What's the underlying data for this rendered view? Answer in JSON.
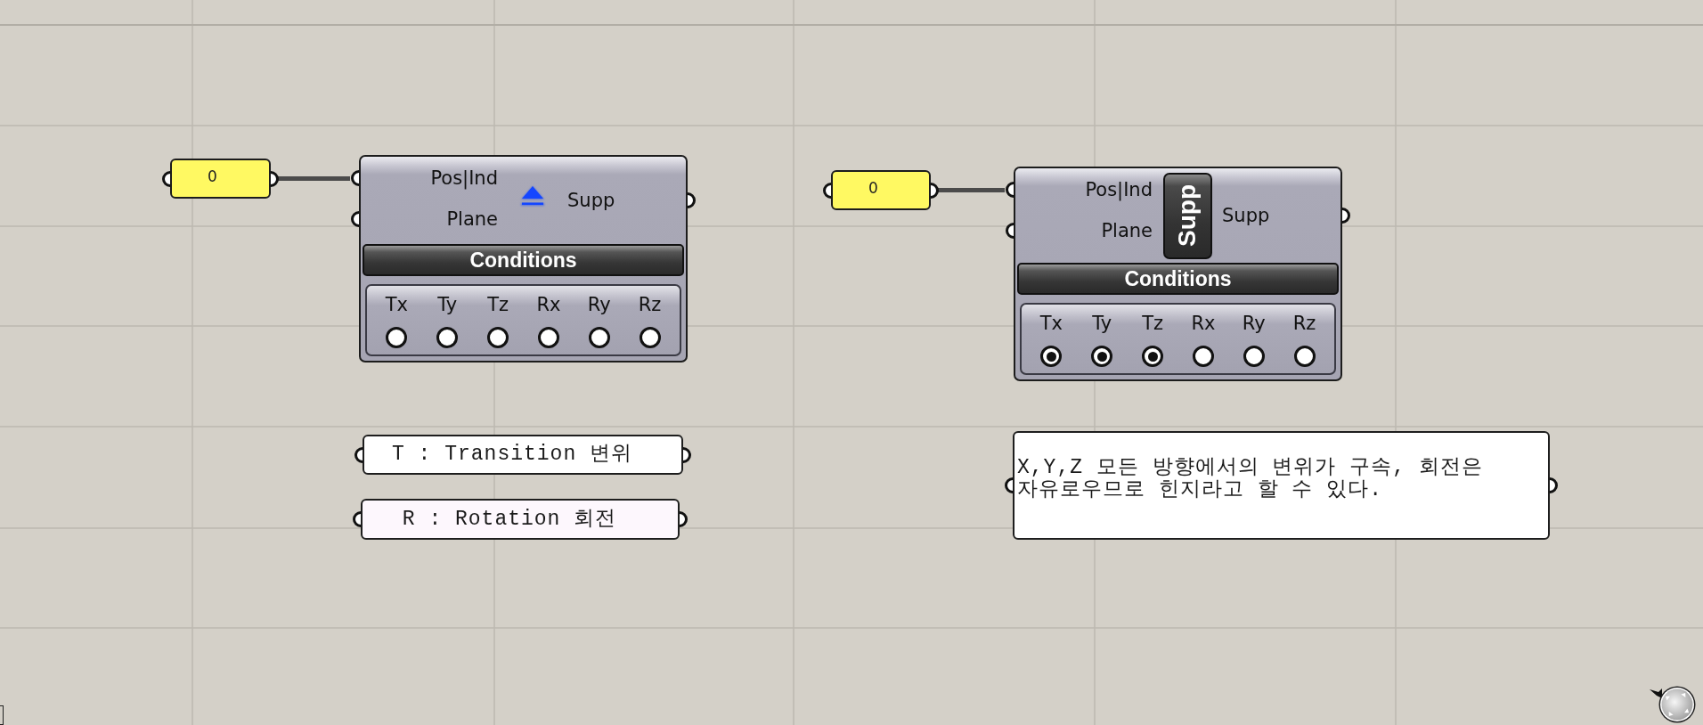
{
  "canvas": {
    "groups": [
      {
        "slider": {
          "value": "0"
        },
        "component": {
          "kind": "icon",
          "inputs": [
            "Pos|Ind",
            "Plane"
          ],
          "output": "Supp",
          "section_title": "Conditions",
          "conditions": [
            {
              "label": "Tx",
              "checked": false
            },
            {
              "label": "Ty",
              "checked": false
            },
            {
              "label": "Tz",
              "checked": false
            },
            {
              "label": "Rx",
              "checked": false
            },
            {
              "label": "Ry",
              "checked": false
            },
            {
              "label": "Rz",
              "checked": false
            }
          ]
        }
      },
      {
        "slider": {
          "value": "0"
        },
        "component": {
          "kind": "name",
          "name": "Supp",
          "inputs": [
            "Pos|Ind",
            "Plane"
          ],
          "output": "Supp",
          "section_title": "Conditions",
          "conditions": [
            {
              "label": "Tx",
              "checked": true
            },
            {
              "label": "Ty",
              "checked": true
            },
            {
              "label": "Tz",
              "checked": true
            },
            {
              "label": "Rx",
              "checked": false
            },
            {
              "label": "Ry",
              "checked": false
            },
            {
              "label": "Rz",
              "checked": false
            }
          ]
        }
      }
    ],
    "panels": [
      {
        "text": "T : Transition 변위",
        "color": "#ffffff"
      },
      {
        "text": "R : Rotation 회전",
        "color": "#fdf7fd"
      },
      {
        "text": "X,Y,Z 모든 방향에서의 변위가 구속, 회전은 자유로우므로 힌지라고 할 수 있다.",
        "color": "#ffffff"
      }
    ]
  }
}
